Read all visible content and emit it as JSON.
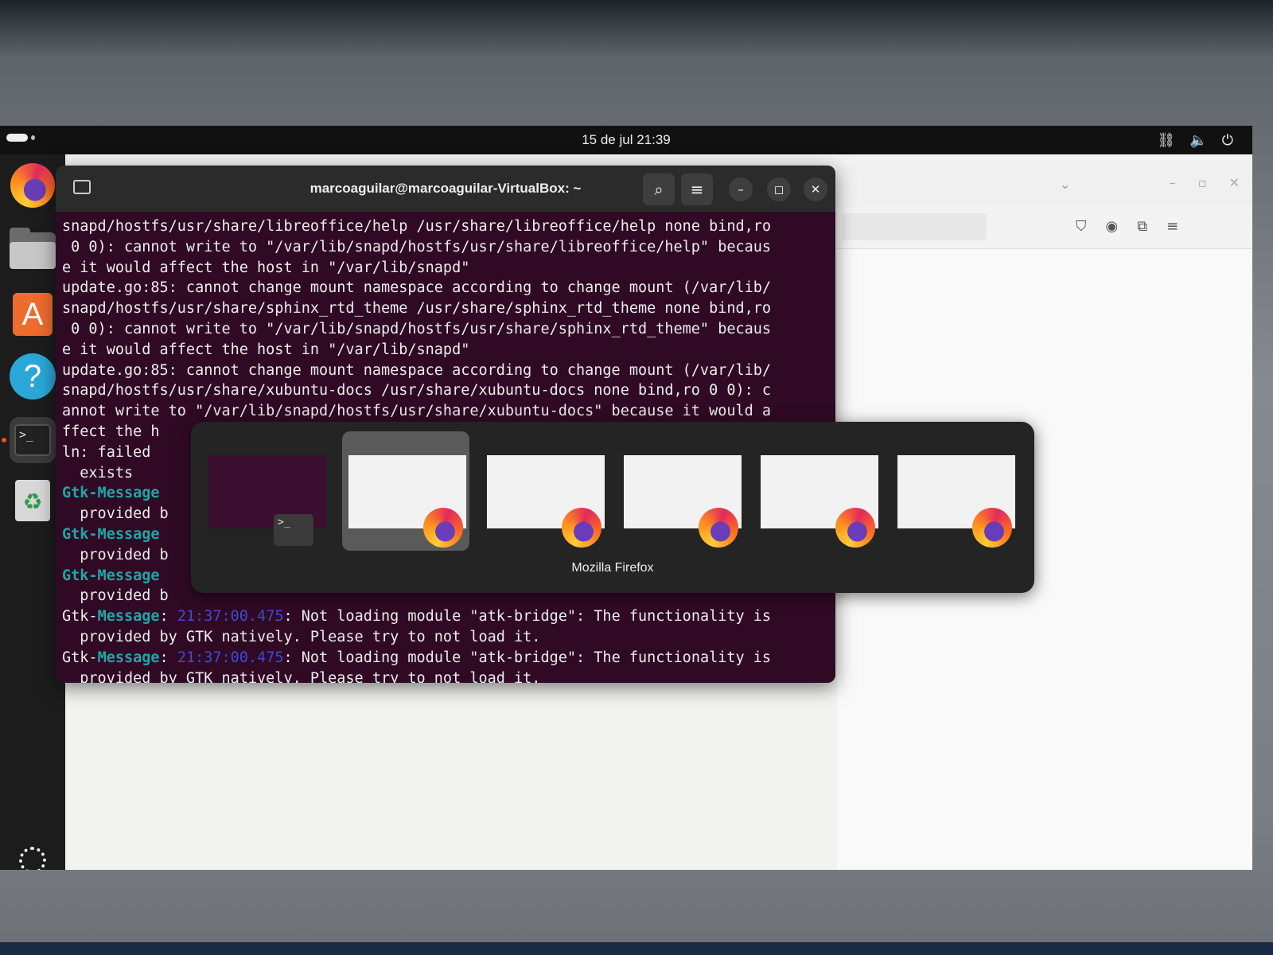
{
  "topbar": {
    "clock": "15 de jul  21:39",
    "tray_icons": [
      "network-icon",
      "volume-icon",
      "power-icon"
    ]
  },
  "dock": {
    "items": [
      {
        "name": "firefox",
        "icon": "firefox-icon"
      },
      {
        "name": "files",
        "icon": "files-icon"
      },
      {
        "name": "app-center",
        "icon": "app-center-icon"
      },
      {
        "name": "help",
        "icon": "help-icon"
      },
      {
        "name": "terminal",
        "icon": "terminal-icon",
        "active": true
      },
      {
        "name": "trash",
        "icon": "trash-icon"
      }
    ],
    "help_glyph": "?",
    "store_glyph": "A",
    "term_glyph": ">_",
    "trash_glyph": "♻"
  },
  "terminal": {
    "title": "marcoaguilar@marcoaguilar-VirtualBox: ~",
    "lines": [
      "snapd/hostfs/usr/share/libreoffice/help /usr/share/libreoffice/help none bind,ro",
      " 0 0): cannot write to \"/var/lib/snapd/hostfs/usr/share/libreoffice/help\" becaus",
      "e it would affect the host in \"/var/lib/snapd\"",
      "update.go:85: cannot change mount namespace according to change mount (/var/lib/",
      "snapd/hostfs/usr/share/sphinx_rtd_theme /usr/share/sphinx_rtd_theme none bind,ro",
      " 0 0): cannot write to \"/var/lib/snapd/hostfs/usr/share/sphinx_rtd_theme\" becaus",
      "e it would affect the host in \"/var/lib/snapd\"",
      "update.go:85: cannot change mount namespace according to change mount (/var/lib/",
      "snapd/hostfs/usr/share/xubuntu-docs /usr/share/xubuntu-docs none bind,ro 0 0): c",
      "annot write to \"/var/lib/snapd/hostfs/usr/share/xubuntu-docs\" because it would a",
      "ffect the h",
      "ln: failed",
      "  exists"
    ],
    "partial_gtk_lines": [
      {
        "key": "Gtk-Message",
        "rest": ""
      },
      {
        "key": "",
        "rest": "  provided b"
      },
      {
        "key": "Gtk-Message",
        "rest": ""
      },
      {
        "key": "",
        "rest": "  provided b"
      },
      {
        "key": "Gtk-Message",
        "rest": ""
      },
      {
        "key": "",
        "rest": "  provided b"
      }
    ],
    "gtk_messages": [
      {
        "prefix": "Gtk-",
        "key": "Message",
        "colon": ": ",
        "time": "21:37:00.475",
        "msg": ": Not loading module \"atk-bridge\": The functionality is",
        "cont": "  provided by GTK natively. Please try to not load it."
      },
      {
        "prefix": "Gtk-",
        "key": "Message",
        "colon": ": ",
        "time": "21:37:00.475",
        "msg": ": Not loading module \"atk-bridge\": The functionality is",
        "cont": "  provided by GTK natively. Please try to not load it."
      }
    ]
  },
  "switcher": {
    "label": "Mozilla Firefox",
    "term_thumb_glyph": ">_",
    "windows": [
      {
        "app": "terminal",
        "selected": false
      },
      {
        "app": "firefox",
        "selected": true
      },
      {
        "app": "firefox",
        "selected": false
      },
      {
        "app": "firefox",
        "selected": false
      },
      {
        "app": "firefox",
        "selected": false
      },
      {
        "app": "firefox",
        "selected": false
      }
    ]
  },
  "firefox_window": {
    "toolbar_icons": [
      "pocket-icon",
      "account-icon",
      "extensions-icon",
      "menu-icon"
    ]
  },
  "colors": {
    "terminal_bg": "#300a24",
    "gtk_key": "#1ba8a8",
    "timestamp": "#3d4bd1",
    "accent": "#e9541d"
  }
}
